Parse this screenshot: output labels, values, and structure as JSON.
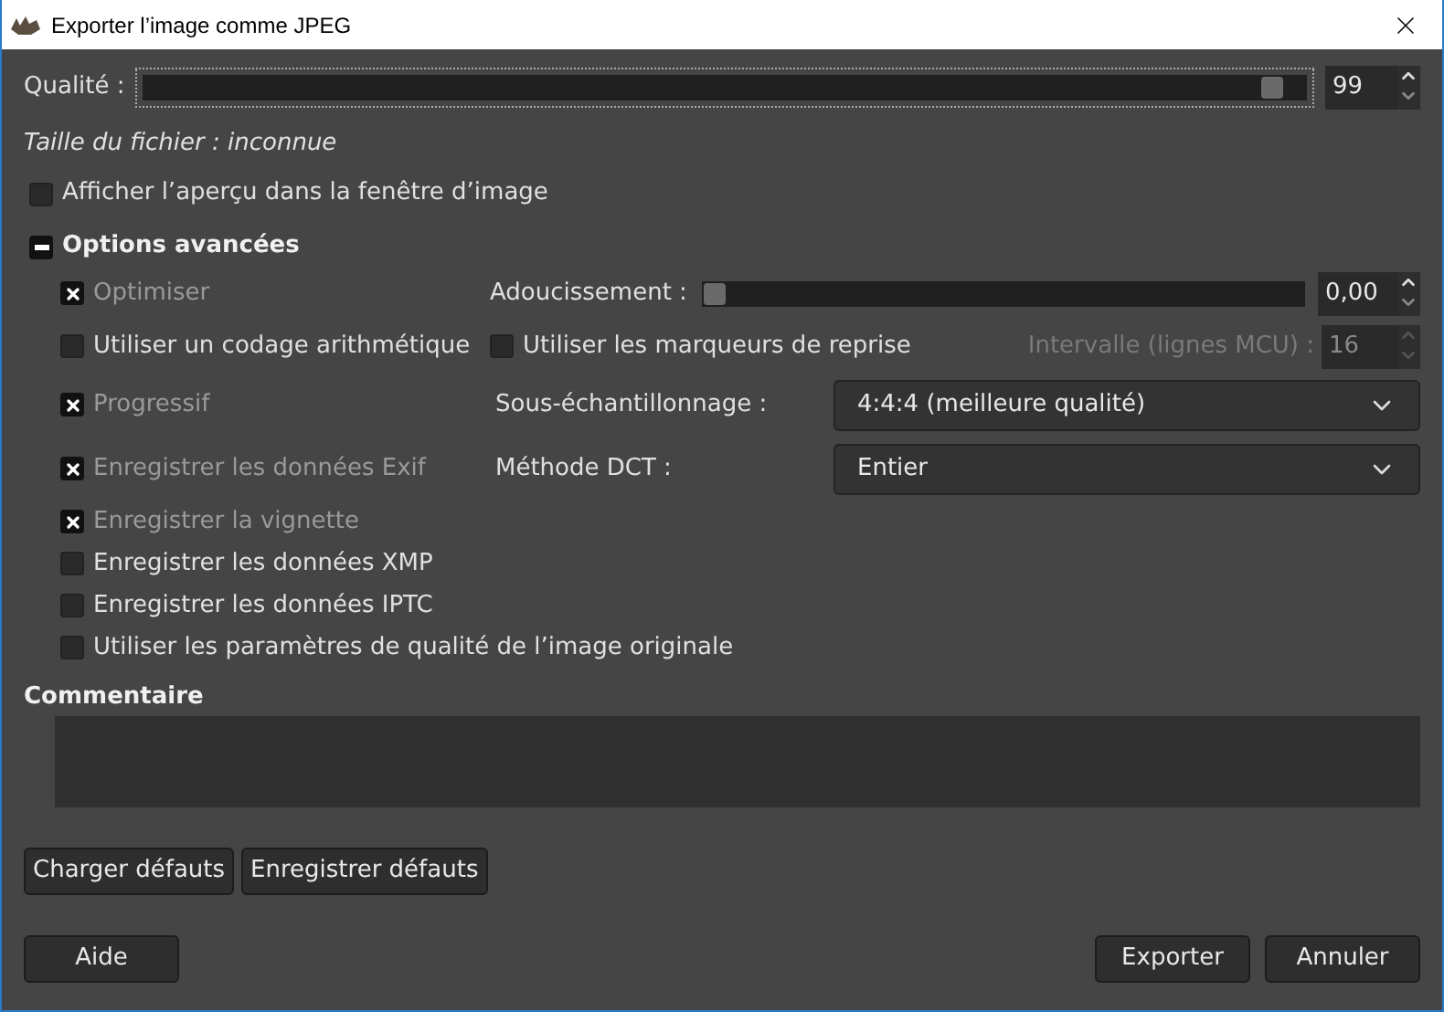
{
  "window": {
    "title": "Exporter l’image comme JPEG"
  },
  "quality": {
    "label": "Qualité :",
    "level": 0.98,
    "value": "99"
  },
  "file_size": "Taille du fichier : inconnue",
  "preview": {
    "label": "Afficher l’aperçu dans la fenêtre d’image",
    "checked": false
  },
  "advanced": {
    "label": "Options avancées",
    "expanded": true,
    "rows": [
      {
        "option": {
          "label": "Optimiser",
          "checked": true
        },
        "control": {
          "kind": "slider",
          "label": "Adoucissement :",
          "level": 0,
          "value": "0,00"
        }
      },
      {
        "option": {
          "label": "Utiliser un codage arithmétique",
          "checked": false
        },
        "control": {
          "kind": "marker",
          "checkbox": {
            "label": "Utiliser les marqueurs de reprise",
            "checked": false
          },
          "label": "Intervalle (lignes MCU) :",
          "value": "16",
          "disabled": true
        }
      },
      {
        "option": {
          "label": "Progressif",
          "checked": true
        },
        "control": {
          "kind": "select",
          "label": "Sous-échantillonnage :",
          "value": "4:4:4 (meilleure qualité)"
        }
      },
      {
        "option": {
          "label": "Enregistrer les données Exif",
          "checked": true
        },
        "control": {
          "kind": "select",
          "label": "Méthode DCT :",
          "value": "Entier"
        }
      }
    ],
    "more_options": [
      {
        "label": "Enregistrer la vignette",
        "checked": true
      },
      {
        "label": "Enregistrer les données XMP",
        "checked": false
      },
      {
        "label": "Enregistrer les données IPTC",
        "checked": false
      },
      {
        "label": "Utiliser les paramètres de qualité de l’image originale",
        "checked": false
      }
    ]
  },
  "comment": {
    "label": "Commentaire"
  },
  "default_buttons": [
    "Charger défauts",
    "Enregistrer défauts"
  ],
  "help_button": "Aide",
  "action_buttons": [
    "Exporter",
    "Annuler"
  ]
}
